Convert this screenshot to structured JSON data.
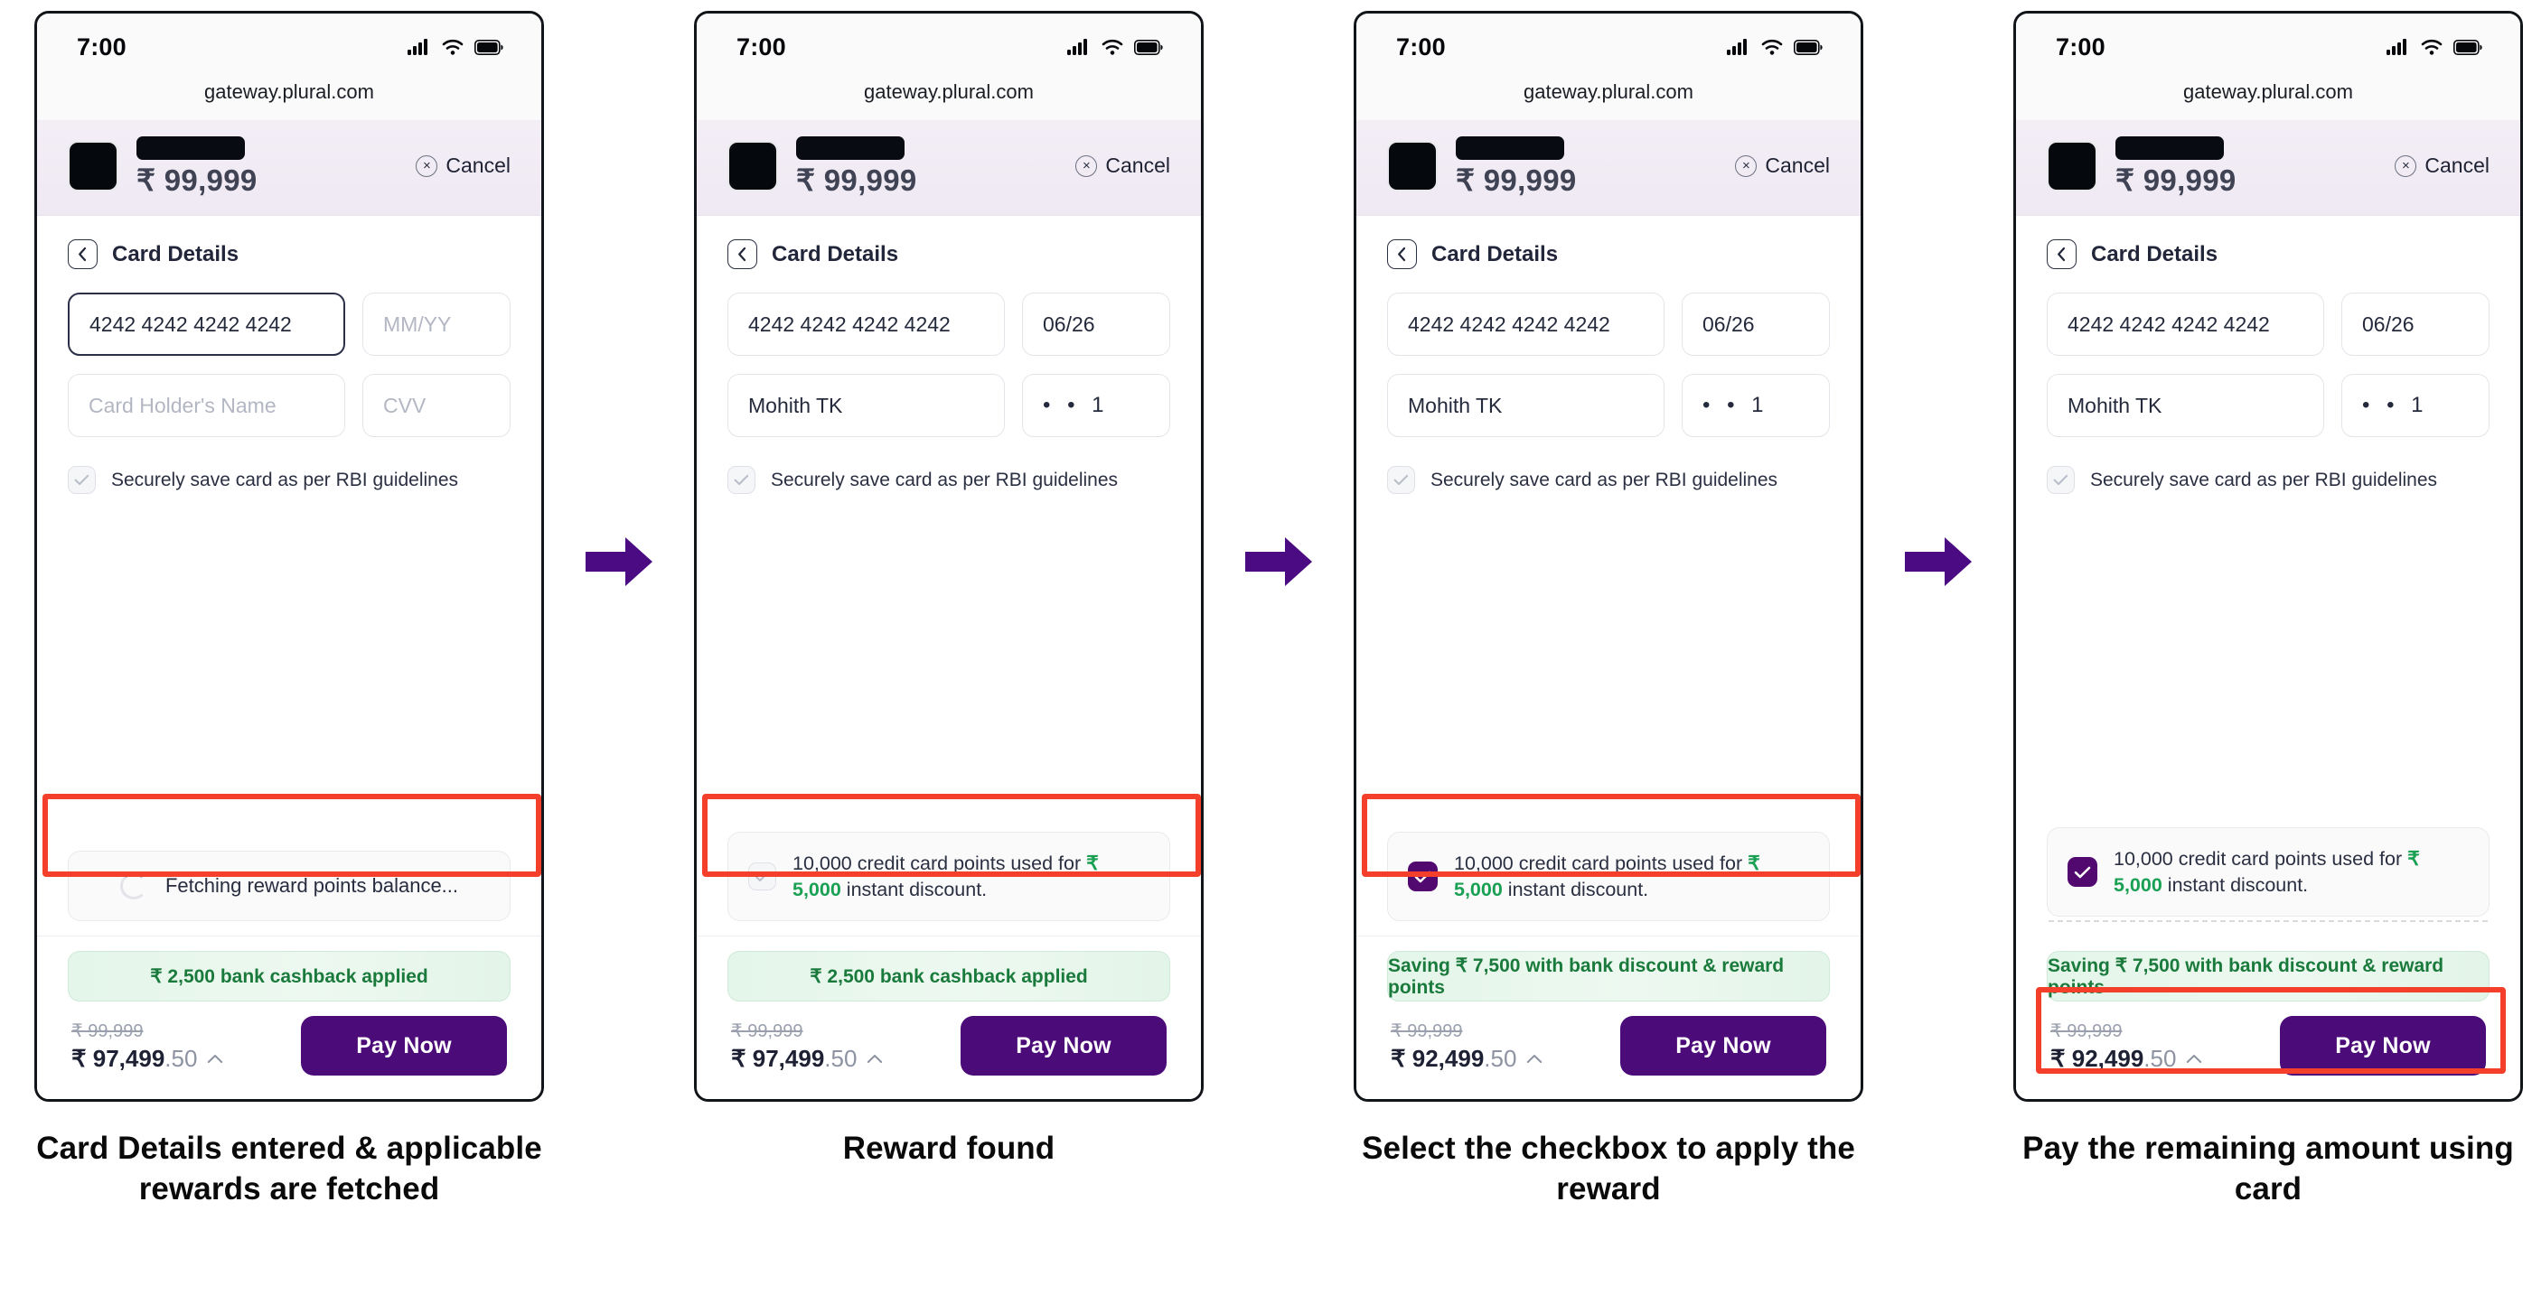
{
  "status_bar": {
    "time": "7:00",
    "signal_icon": "cellular-bars-icon",
    "wifi_icon": "wifi-icon",
    "battery_icon": "battery-full-icon"
  },
  "browser": {
    "url": "gateway.plural.com"
  },
  "header": {
    "merchant_logo": "merchant-logo-redacted",
    "merchant_name": "merchant-name-redacted",
    "amount": "₹ 99,999",
    "cancel_label": "Cancel",
    "cancel_icon": "close-circle-icon"
  },
  "section": {
    "back_icon": "chevron-left-icon",
    "title": "Card Details"
  },
  "form": {
    "card_number_value": "4242 4242 4242 4242",
    "expiry_placeholder": "MM/YY",
    "expiry_value": "06/26",
    "name_placeholder": "Card Holder's Name",
    "name_value": "Mohith TK",
    "cvv_placeholder": "CVV",
    "cvv_value": "• • 1",
    "save_card_label": "Securely save card as per RBI guidelines",
    "save_card_icon": "check-icon"
  },
  "reward": {
    "loading_text": "Fetching reward points balance...",
    "loading_icon": "spinner-icon",
    "text_before": "10,000 credit card points used for ",
    "amount": "₹ 5,000",
    "text_after": " instant discount.",
    "check_icon": "check-icon"
  },
  "footer": {
    "cashback_banner": "₹ 2,500 bank cashback applied",
    "savings_banner": "Saving ₹ 7,500 with bank discount & reward points",
    "original_amount": "₹ 99,999",
    "payable_cashback_only": "₹ 97,499",
    "payable_with_reward": "₹ 92,499",
    "decimals": ".50",
    "chevron_icon": "chevron-up-icon",
    "pay_now_label": "Pay Now"
  },
  "colors": {
    "brand_purple": "#4b0b78",
    "checkbox_purple": "#52096f",
    "green": "#1aa053",
    "highlight_red": "#f4402a",
    "arrow_purple": "#4b0b82"
  },
  "steps": [
    {
      "caption": "Card Details entered & applicable rewards are fetched"
    },
    {
      "caption": "Reward found"
    },
    {
      "caption": "Select the checkbox to apply the reward"
    },
    {
      "caption": "Pay the remaining amount using card"
    }
  ],
  "flow_arrow_icon": "arrow-right-icon"
}
